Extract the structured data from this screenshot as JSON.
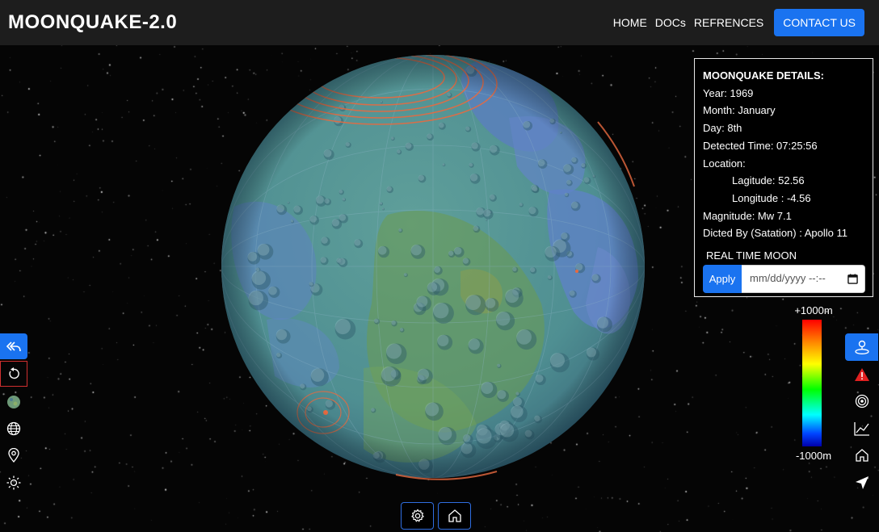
{
  "app": {
    "brand": "MOONQUAKE-2.0"
  },
  "nav": {
    "home": "HOME",
    "docs": "DOCs",
    "references": "REFRENCES",
    "contact": "CONTACT US"
  },
  "details": {
    "heading": "MOONQUAKE DETAILS:",
    "year": "Year: 1969",
    "month": "Month: January",
    "day": "Day: 8th",
    "detected_time": "Detected Time: 07:25:56",
    "location_label": "Location:",
    "latitude": "Lagitude: 52.56",
    "longitude": "Longitude : -4.56",
    "magnitude": "Magnitude: Mw 7.1",
    "detected_by": "Dicted By (Satation) : Apollo 11"
  },
  "realtime": {
    "label": "REAL TIME MOON",
    "apply": "Apply",
    "date_placeholder": "mm/dd/yyyy --:-- "
  },
  "scale": {
    "top": "+1000m",
    "bottom": "-1000m"
  },
  "colors": {
    "accent": "#1a73f0",
    "topbar": "#1d1d1d",
    "warning": "#e02020"
  },
  "icons": {
    "left_toolbar": [
      "reply-all-icon",
      "rotate-icon",
      "moon-texture-icon",
      "globe-icon",
      "location-pin-icon",
      "sun-icon"
    ],
    "right_toolbar": [
      "person-pin-icon",
      "warning-icon",
      "target-icon",
      "line-chart-icon",
      "home-icon",
      "navigation-arrow-icon"
    ],
    "bottom_toolbar": [
      "gear-icon",
      "home-icon"
    ]
  }
}
